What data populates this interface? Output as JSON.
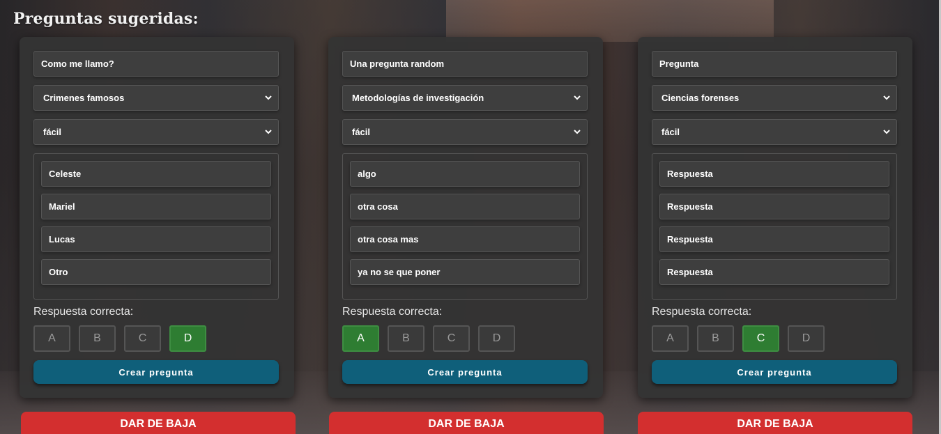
{
  "page": {
    "title": "Preguntas sugeridas:"
  },
  "cards": [
    {
      "question": "Como me llamo?",
      "category": "Crimenes famosos",
      "difficulty": "fácil",
      "answers": [
        "Celeste",
        "Mariel",
        "Lucas",
        "Otro"
      ],
      "correct_label": "Respuesta correcta:",
      "letters": [
        "A",
        "B",
        "C",
        "D"
      ],
      "selected": "D",
      "create_label": "Crear pregunta",
      "drop_label": "DAR DE BAJA"
    },
    {
      "question": "Una pregunta random",
      "category": "Metodologías de investigación",
      "difficulty": "fácil",
      "answers": [
        "algo",
        "otra cosa",
        "otra cosa mas",
        "ya no se que poner"
      ],
      "correct_label": "Respuesta correcta:",
      "letters": [
        "A",
        "B",
        "C",
        "D"
      ],
      "selected": "A",
      "create_label": "Crear pregunta",
      "drop_label": "DAR DE BAJA"
    },
    {
      "question": "Pregunta",
      "category": "Ciencias forenses",
      "difficulty": "fácil",
      "answers": [
        "Respuesta",
        "Respuesta",
        "Respuesta",
        "Respuesta"
      ],
      "correct_label": "Respuesta correcta:",
      "letters": [
        "A",
        "B",
        "C",
        "D"
      ],
      "selected": "C",
      "create_label": "Crear pregunta",
      "drop_label": "DAR DE BAJA"
    }
  ],
  "colors": {
    "selected": "#2e7d32",
    "create_button": "#0f5f7a",
    "drop_button": "#d32f2f"
  }
}
